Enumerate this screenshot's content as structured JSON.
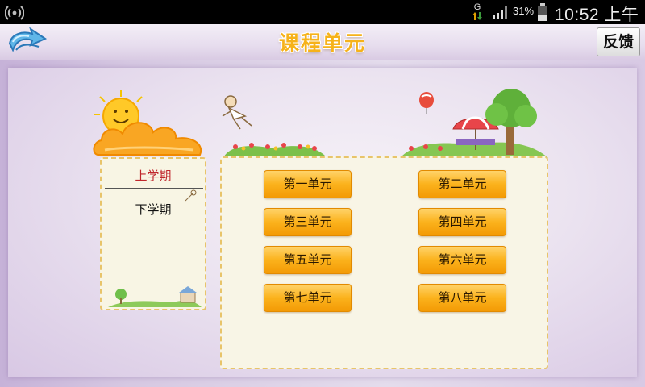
{
  "status_bar": {
    "network_type": "G",
    "battery_percent": "31%",
    "time": "10:52 上午"
  },
  "header": {
    "title": "课程单元",
    "feedback_label": "反馈"
  },
  "semesters": [
    {
      "label": "上学期",
      "selected": true
    },
    {
      "label": "下学期",
      "selected": false
    }
  ],
  "units": [
    {
      "label": "第一单元"
    },
    {
      "label": "第二单元"
    },
    {
      "label": "第三单元"
    },
    {
      "label": "第四单元"
    },
    {
      "label": "第五单元"
    },
    {
      "label": "第六单元"
    },
    {
      "label": "第七单元"
    },
    {
      "label": "第八单元"
    }
  ],
  "colors": {
    "title": "#f6b21a",
    "unit_button": "#fbb21c",
    "selected_semester": "#c0262c",
    "panel_background": "#f8f5e6",
    "panel_border": "#e8c46a"
  },
  "icons": {
    "status_left": "wireless-icon",
    "signal": "signal-bars-icon",
    "battery": "battery-icon",
    "back": "back-arrow-icon"
  }
}
